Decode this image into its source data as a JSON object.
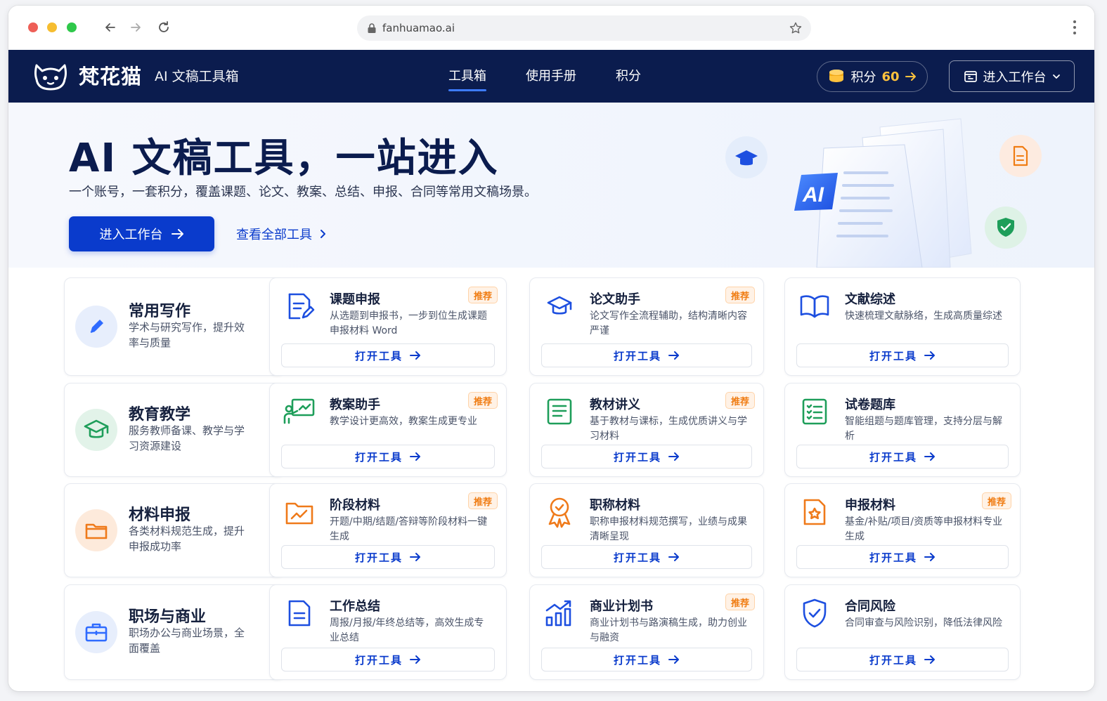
{
  "browser": {
    "url": "fanhuamao.ai"
  },
  "nav": {
    "brand_name": "梵花猫",
    "brand_sub": "AI 文稿工具箱",
    "menu": [
      {
        "label": "工具箱",
        "active": true
      },
      {
        "label": "使用手册",
        "active": false
      },
      {
        "label": "积分",
        "active": false
      }
    ],
    "points_label": "积分",
    "points_value": "60",
    "workbench_label": "进入工作台"
  },
  "hero": {
    "title": "AI 文稿工具，一站进入",
    "description": "一个账号，一套积分，覆盖课题、论文、教案、总结、申报、合同等常用文稿场景。",
    "cta_label": "进入工作台",
    "link_label": "查看全部工具",
    "ai_badge": "AI"
  },
  "categories": [
    {
      "title": "常用写作",
      "desc": "学术与研究写作，提升效率与质量",
      "icon": "pencil-icon",
      "color": "#2f6bff",
      "tools": [
        {
          "title": "课题申报",
          "desc": "从选题到申报书，一步到位生成课题申报材料 Word",
          "icon": "document-edit-icon",
          "badge": "推荐",
          "open": "打开工具"
        },
        {
          "title": "论文助手",
          "desc": "论文写作全流程辅助，结构清晰内容严谨",
          "icon": "graduation-cap-icon",
          "badge": "推荐",
          "open": "打开工具"
        },
        {
          "title": "文献综述",
          "desc": "快速梳理文献脉络，生成高质量综述",
          "icon": "open-book-icon",
          "badge": "",
          "open": "打开工具"
        }
      ]
    },
    {
      "title": "教育教学",
      "desc": "服务教师备课、教学与学习资源建设",
      "icon": "graduation-cap-icon",
      "color": "#1e9e5a",
      "tools": [
        {
          "title": "教案助手",
          "desc": "教学设计更高效，教案生成更专业",
          "icon": "teacher-board-icon",
          "badge": "推荐",
          "open": "打开工具"
        },
        {
          "title": "教材讲义",
          "desc": "基于教材与课标，生成优质讲义与学习材料",
          "icon": "handout-icon",
          "badge": "推荐",
          "open": "打开工具"
        },
        {
          "title": "试卷题库",
          "desc": "智能组题与题库管理，支持分层与解析",
          "icon": "checklist-icon",
          "badge": "",
          "open": "打开工具"
        }
      ]
    },
    {
      "title": "材料申报",
      "desc": "各类材料规范生成，提升申报成功率",
      "icon": "folder-icon",
      "color": "#ef7a1a",
      "tools": [
        {
          "title": "阶段材料",
          "desc": "开题/中期/结题/答辩等阶段材料一键生成",
          "icon": "chart-folder-icon",
          "badge": "推荐",
          "open": "打开工具"
        },
        {
          "title": "职称材料",
          "desc": "职称申报材料规范撰写，业绩与成果清晰呈现",
          "icon": "award-icon",
          "badge": "",
          "open": "打开工具"
        },
        {
          "title": "申报材料",
          "desc": "基金/补贴/项目/资质等申报材料专业生成",
          "icon": "star-document-icon",
          "badge": "推荐",
          "open": "打开工具"
        }
      ]
    },
    {
      "title": "职场与商业",
      "desc": "职场办公与商业场景，全面覆盖",
      "icon": "briefcase-icon",
      "color": "#2f6bff",
      "tools": [
        {
          "title": "工作总结",
          "desc": "周报/月报/年终总结等，高效生成专业总结",
          "icon": "document-icon",
          "badge": "",
          "open": "打开工具"
        },
        {
          "title": "商业计划书",
          "desc": "商业计划书与路演稿生成，助力创业与融资",
          "icon": "bar-chart-icon",
          "badge": "推荐",
          "open": "打开工具"
        },
        {
          "title": "合同风险",
          "desc": "合同审查与风险识别，降低法律风险",
          "icon": "shield-check-icon",
          "badge": "",
          "open": "打开工具"
        }
      ]
    }
  ]
}
